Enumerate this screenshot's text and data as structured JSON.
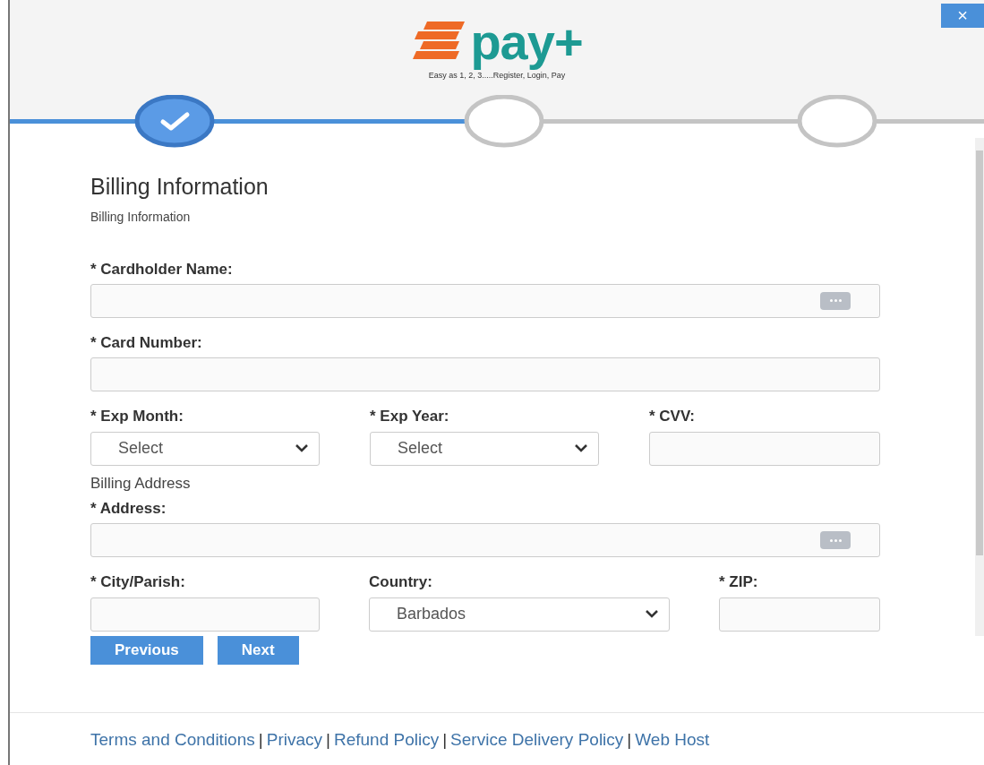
{
  "close_button": {
    "label": "×"
  },
  "logo": {
    "wordmark": "pay+",
    "tagline": "Easy as 1, 2, 3.....Register, Login, Pay"
  },
  "steps": [
    {
      "done": true,
      "selected": true
    },
    {
      "done": false,
      "selected": false
    },
    {
      "done": false,
      "selected": false
    }
  ],
  "form": {
    "title": "Billing Information",
    "subtitle": "Billing Information",
    "items": [
      {
        "kind": "row",
        "fields": [
          {
            "label": "* Cardholder Name:",
            "kind": "text",
            "key_icon": true
          }
        ]
      },
      {
        "kind": "row",
        "fields": [
          {
            "label": "* Card Number:",
            "kind": "text",
            "key_icon": false
          }
        ]
      },
      {
        "kind": "row",
        "fields": [
          {
            "label": "* Exp Month:",
            "kind": "select",
            "value": "Select"
          },
          {
            "label": "* Exp Year:",
            "kind": "select",
            "value": "Select"
          },
          {
            "label": "* CVV:",
            "kind": "text",
            "key_icon": false
          }
        ]
      },
      {
        "kind": "section",
        "label": "Billing Address"
      },
      {
        "kind": "row",
        "fields": [
          {
            "label": "* Address:",
            "kind": "text",
            "key_icon": true
          }
        ]
      },
      {
        "kind": "row",
        "fields": [
          {
            "label": "* City/Parish:",
            "kind": "text",
            "key_icon": false
          },
          {
            "label": "Country:",
            "kind": "select",
            "value": "Barbados"
          },
          {
            "label": "* ZIP:",
            "kind": "text",
            "key_icon": false
          }
        ]
      }
    ]
  },
  "buttons": [
    "Previous",
    "Next"
  ],
  "footer_separator": "|",
  "footer_links": [
    "Terms and Conditions",
    "Privacy",
    "Refund Policy",
    "Service Delivery Policy",
    "Web Host"
  ]
}
